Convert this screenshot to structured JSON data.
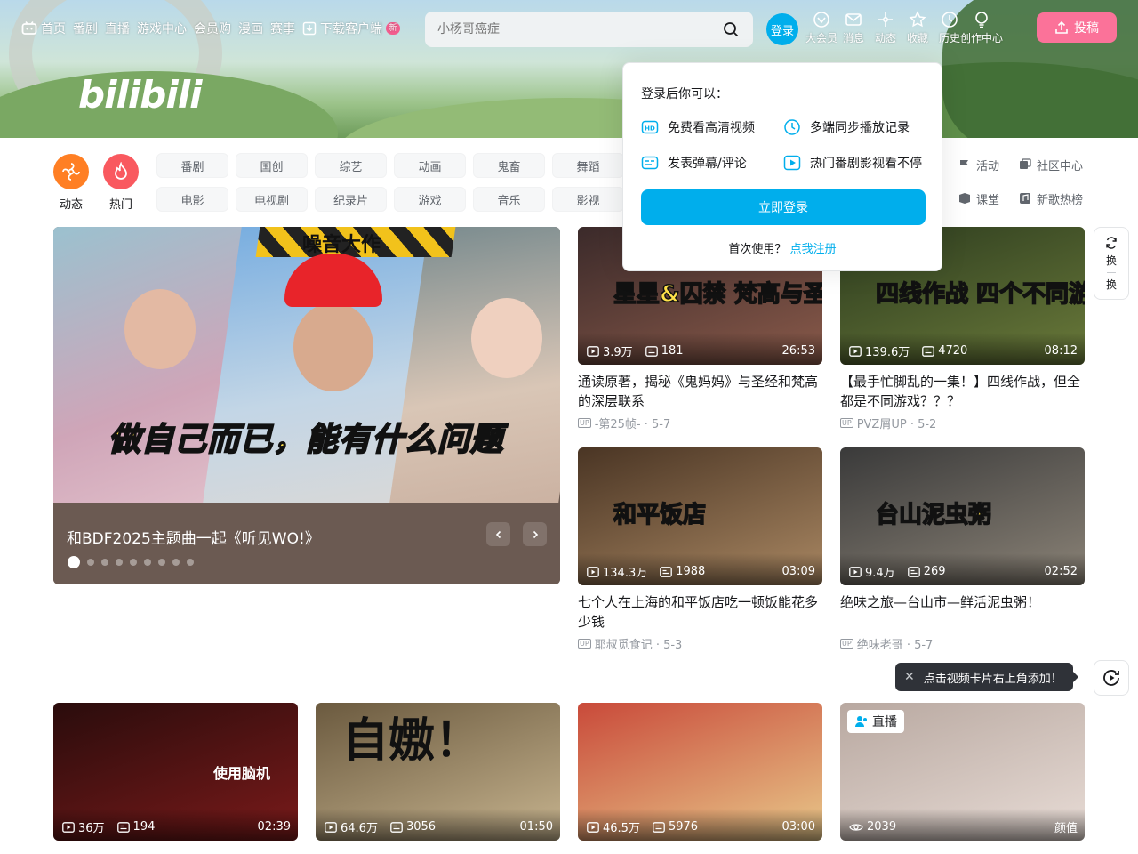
{
  "header": {
    "nav": [
      {
        "label": "首页",
        "icon": "tv-icon"
      },
      {
        "label": "番剧"
      },
      {
        "label": "直播"
      },
      {
        "label": "游戏中心"
      },
      {
        "label": "会员购"
      },
      {
        "label": "漫画"
      },
      {
        "label": "赛事"
      },
      {
        "label": "下载客户端",
        "icon": "download-icon",
        "badge": "新"
      }
    ],
    "search_placeholder": "小杨哥癌症",
    "login_label": "登录",
    "entries": [
      {
        "label": "大会员",
        "icon": "vip-icon"
      },
      {
        "label": "消息",
        "icon": "message-icon"
      },
      {
        "label": "动态",
        "icon": "dynamic-icon"
      },
      {
        "label": "收藏",
        "icon": "star-icon"
      },
      {
        "label": "历史",
        "icon": "clock-icon"
      },
      {
        "label": "创作中心",
        "icon": "bulb-icon"
      }
    ],
    "upload_label": "投稿",
    "logo_text": "bilibili"
  },
  "channels": {
    "icons": [
      {
        "label": "动态",
        "color": "#ff7f24"
      },
      {
        "label": "热门",
        "color": "#f9595f"
      }
    ],
    "chips": [
      "番剧",
      "国创",
      "综艺",
      "动画",
      "鬼畜",
      "舞蹈",
      "电影",
      "电视剧",
      "纪录片",
      "游戏",
      "音乐",
      "影视"
    ],
    "side_links": [
      {
        "label": "活动",
        "icon": "flag-icon"
      },
      {
        "label": "社区中心",
        "icon": "community-icon"
      },
      {
        "label": "课堂",
        "icon": "class-icon"
      },
      {
        "label": "新歌热榜",
        "icon": "music-chart-icon"
      }
    ]
  },
  "carousel": {
    "caption": "和BDF2025主题曲一起《听见WO!》",
    "overlay_text": "做自己而已，能有什么问题",
    "stripe_text": "噪音大作",
    "dot_count": 9,
    "active_dot": 0
  },
  "videos": [
    {
      "views": "3.9万",
      "danmaku": "181",
      "duration": "26:53",
      "title": "通读原著，揭秘《鬼妈妈》与圣经和梵高的深层联系",
      "author": "-第25帧-",
      "date": "5-7",
      "thumb_text": "星星&囚禁 梵高与圣经",
      "colors": [
        "#3b2a2a",
        "#8a5a4a"
      ]
    },
    {
      "views": "139.6万",
      "danmaku": "4720",
      "duration": "08:12",
      "title": "【最手忙脚乱的一集！】四线作战，但全都是不同游戏？？？",
      "author": "PVZ屑UP",
      "date": "5-2",
      "thumb_text": "四线作战 四个不同游戏",
      "colors": [
        "#2c3b1e",
        "#6a7a3a"
      ]
    },
    {
      "views": "134.3万",
      "danmaku": "1988",
      "duration": "03:09",
      "title": "七个人在上海的和平饭店吃一顿饭能花多少钱",
      "author": "耶叔觅食记",
      "date": "5-3",
      "thumb_text": "和平饭店",
      "colors": [
        "#4a3524",
        "#a98762"
      ]
    },
    {
      "views": "9.4万",
      "danmaku": "269",
      "duration": "02:52",
      "title": "绝味之旅—台山市—鲜活泥虫粥！",
      "author": "绝味老哥",
      "date": "5-7",
      "thumb_text": "台山泥虫粥",
      "colors": [
        "#3a3a3a",
        "#8b8377"
      ]
    },
    {
      "views": "36万",
      "danmaku": "194",
      "duration": "02:39",
      "title": "",
      "author": "",
      "date": "",
      "thumb_text": "使用脑机",
      "colors": [
        "#2a0c0c",
        "#7a1a1a"
      ]
    },
    {
      "views": "64.6万",
      "danmaku": "3056",
      "duration": "01:50",
      "title": "",
      "author": "",
      "date": "",
      "thumb_text": "自嫐！",
      "colors": [
        "#6b5a3f",
        "#c7b48f"
      ]
    },
    {
      "views": "46.5万",
      "danmaku": "5976",
      "duration": "03:00",
      "title": "",
      "author": "",
      "date": "",
      "thumb_text": "",
      "colors": [
        "#c94a3a",
        "#e8c88a"
      ]
    },
    {
      "views": "2039",
      "danmaku": "",
      "duration": "颜值",
      "title": "",
      "author": "",
      "date": "",
      "thumb_text": "",
      "colors": [
        "#b8a8a0",
        "#e8dcd6"
      ],
      "live_label": "直播"
    }
  ],
  "login_popover": {
    "title": "登录后你可以：",
    "benefits": [
      {
        "label": "免费看高清视频",
        "icon": "hd-icon"
      },
      {
        "label": "多端同步播放记录",
        "icon": "sync-clock-icon"
      },
      {
        "label": "发表弹幕/评论",
        "icon": "danmaku-icon"
      },
      {
        "label": "热门番剧影视看不停",
        "icon": "play-icon"
      }
    ],
    "login_button": "立即登录",
    "register_prompt": "首次使用？",
    "register_link": "点我注册"
  },
  "refresh": {
    "label_top": "换",
    "label_bottom": "换"
  },
  "tip": {
    "text": "点击视频卡片右上角添加！"
  },
  "colors": {
    "accent": "#00aeec",
    "pink": "#fb7299"
  }
}
